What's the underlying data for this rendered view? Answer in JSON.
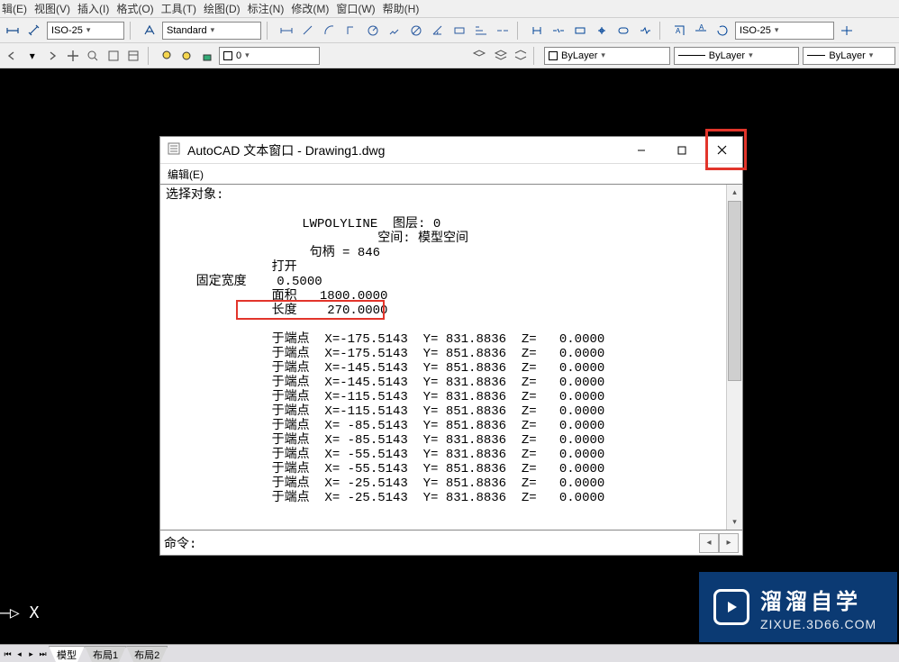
{
  "menubar": {
    "items": [
      "辑(E)",
      "视图(V)",
      "插入(I)",
      "格式(O)",
      "工具(T)",
      "绘图(D)",
      "标注(N)",
      "修改(M)",
      "窗口(W)",
      "帮助(H)"
    ]
  },
  "toolbar1": {
    "combo1": "ISO-25",
    "combo2": "Standard",
    "combo3": "ISO-25"
  },
  "toolbar2": {
    "layer_combo": "0",
    "bylayer_combo1": "ByLayer",
    "bylayer_combo2": "ByLayer",
    "bylayer_combo3": "ByLayer"
  },
  "text_window": {
    "title": "AutoCAD 文本窗口 - Drawing1.dwg",
    "menu_edit": "编辑(E)",
    "sel_label": "选择对象:",
    "line_lwpoly": "                  LWPOLYLINE  图层: 0",
    "line_space": "                            空间: 模型空间",
    "line_handle": "                   句柄 = 846",
    "line_open": "              打开",
    "line_fixedwidth": "    固定宽度    0.5000",
    "line_area": "              面积   1800.0000",
    "line_length": "              长度    270.0000",
    "points": [
      "              于端点  X=-175.5143  Y= 831.8836  Z=   0.0000",
      "              于端点  X=-175.5143  Y= 851.8836  Z=   0.0000",
      "              于端点  X=-145.5143  Y= 851.8836  Z=   0.0000",
      "              于端点  X=-145.5143  Y= 831.8836  Z=   0.0000",
      "              于端点  X=-115.5143  Y= 831.8836  Z=   0.0000",
      "              于端点  X=-115.5143  Y= 851.8836  Z=   0.0000",
      "              于端点  X= -85.5143  Y= 851.8836  Z=   0.0000",
      "              于端点  X= -85.5143  Y= 831.8836  Z=   0.0000",
      "              于端点  X= -55.5143  Y= 831.8836  Z=   0.0000",
      "              于端点  X= -55.5143  Y= 851.8836  Z=   0.0000",
      "              于端点  X= -25.5143  Y= 851.8836  Z=   0.0000",
      "              于端点  X= -25.5143  Y= 831.8836  Z=   0.0000"
    ],
    "cmd_label": "命令:",
    "cmd_value": ""
  },
  "prompt_text": "—▷  X",
  "tabs": {
    "t1": "模型",
    "t2": "布局1",
    "t3": "布局2"
  },
  "watermark": {
    "ch": "溜溜自学",
    "url": "ZIXUE.3D66.COM"
  }
}
